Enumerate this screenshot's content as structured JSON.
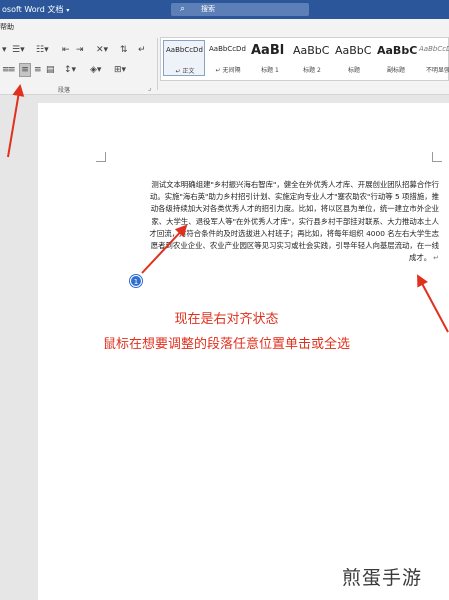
{
  "titlebar": {
    "title": "osoft Word 文档",
    "search_placeholder": "搜索"
  },
  "menu": {
    "tab_help": "帮助"
  },
  "ribbon": {
    "paragraph_group_label": "段落",
    "styles": [
      {
        "preview": "AaBbCcDd",
        "name": "↵ 正文",
        "active": true
      },
      {
        "preview": "AaBbCcDd",
        "name": "↵ 无间隔",
        "active": false
      },
      {
        "preview": "AaBl",
        "name": "标题 1",
        "active": false
      },
      {
        "preview": "AaBbC",
        "name": "标题 2",
        "active": false
      },
      {
        "preview": "AaBbC",
        "name": "标题",
        "active": false
      },
      {
        "preview": "AaBbC",
        "name": "副标题",
        "active": false
      },
      {
        "preview": "AaBbCcD",
        "name": "不明显强",
        "active": false
      }
    ]
  },
  "document": {
    "paragraph_lines": [
      "测试文本明确组建\"乡村振兴海右智库\"，健全在外优秀人才库、开展创业团队招募合作行",
      "动。实施\"海右英\"助力乡村招引计划、实施定向专业人才\"塞农助农\"行动等 5 项措施，推",
      "动各级持续加大对各类优秀人才的招引力度。比如，将以区县为单位，统一建立市外企业",
      "家、大学生、退役军人等\"在外优秀人才库\"，实行县乡村干部挂对联系、大力推动本土人",
      "才回流，对符合条件的及时选拔进入村班子；再比如，将每年组织 4000 名左右大学生志",
      "愿者到农业企业、农业产业园区等见习实习或社会实践，引导年轻人向基层流动，在一线",
      "成才。"
    ],
    "badge_number": "1",
    "annotation_1": "现在是右对齐状态",
    "annotation_2": "鼠标在想要调整的段落任意位置单击或全选"
  },
  "watermark": "煎蛋手游",
  "colors": {
    "titlebar": "#2b579a",
    "annotation_red": "#e0301e",
    "badge_blue": "#2f6fd1"
  }
}
